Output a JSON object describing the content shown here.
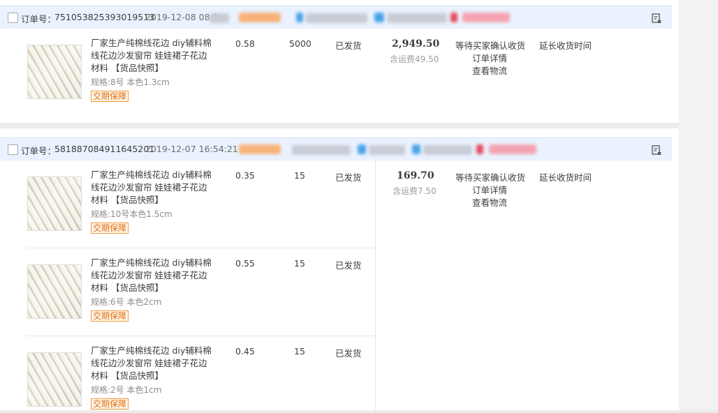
{
  "colors": {
    "header_bg": "#eaf2ff",
    "badge_border": "#f29835",
    "badge_text": "#e46b0a",
    "shipping_gray": "#9c9c9c"
  },
  "orders": [
    {
      "order_label": "订单号：",
      "order_number": "751053825393019513",
      "date_time": "2019-12-08 08:2",
      "total": "2,949.50",
      "shipping_note": "含运费49.50",
      "status": "等待买家确认收货",
      "detail_link": "订单详情",
      "logistics_link": "查看物流",
      "extend_link": "延长收货时间",
      "memo_icon": "flag-memo-icon",
      "items": [
        {
          "title": "厂家生产纯棉线花边 diy辅料棉线花边沙发窗帘 娃娃裙子花边材料 【货品快照】",
          "spec": "规格:8号 本色1.3cm",
          "badge": "交期保障",
          "unit_price": "0.58",
          "quantity": "5000",
          "ship_status": "已发货"
        }
      ]
    },
    {
      "order_label": "订单号：",
      "order_number": "581887084911645201",
      "date_time": "2019-12-07 16:54:21",
      "total": "169.70",
      "shipping_note": "含运费7.50",
      "status": "等待买家确认收货",
      "detail_link": "订单详情",
      "logistics_link": "查看物流",
      "extend_link": "延长收货时间",
      "memo_icon": "flag-memo-icon",
      "items": [
        {
          "title": "厂家生产纯棉线花边 diy辅料棉线花边沙发窗帘 娃娃裙子花边材料 【货品快照】",
          "spec": "规格:10号本色1.5cm",
          "badge": "交期保障",
          "unit_price": "0.35",
          "quantity": "15",
          "ship_status": "已发货"
        },
        {
          "title": "厂家生产纯棉线花边 diy辅料棉线花边沙发窗帘 娃娃裙子花边材料 【货品快照】",
          "spec": "规格:6号 本色2cm",
          "badge": "交期保障",
          "unit_price": "0.55",
          "quantity": "15",
          "ship_status": "已发货"
        },
        {
          "title": "厂家生产纯棉线花边 diy辅料棉线花边沙发窗帘 娃娃裙子花边材料 【货品快照】",
          "spec": "规格:2号 本色1cm",
          "badge": "交期保障",
          "unit_price": "0.45",
          "quantity": "15",
          "ship_status": "已发货"
        }
      ]
    }
  ]
}
